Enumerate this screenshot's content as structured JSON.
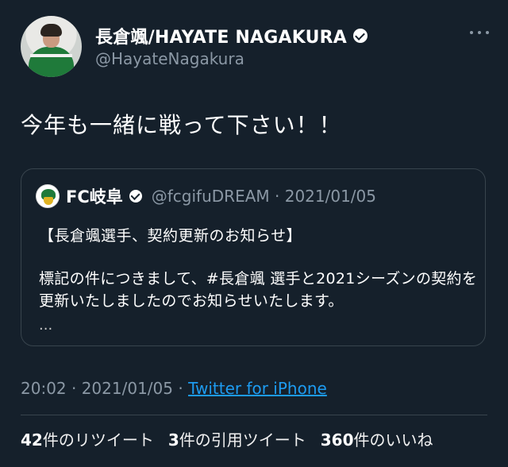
{
  "author": {
    "name": "長倉颯/HAYATE NAGAKURA",
    "handle": "@HayateNagakura",
    "verified": true
  },
  "tweet": {
    "text": "今年も一緒に戦って下さい！！"
  },
  "quoted": {
    "name": "FC岐阜",
    "handle_date": "@fcgifuDREAM · 2021/01/05",
    "title": "【長倉颯選手、契約更新のお知らせ】",
    "body": "標記の件につきまして、#長倉颯 選手と2021シーズンの契約を更新いたしましたのでお知らせいたします。",
    "ellipsis": "..."
  },
  "meta": {
    "time_date": "20:02 · 2021/01/05 · ",
    "source": "Twitter for iPhone"
  },
  "stats": {
    "retweets_num": "42",
    "retweets_label": "件のリツイート",
    "quotes_num": "3",
    "quotes_label": "件の引用ツイート",
    "likes_num": "360",
    "likes_label": "件のいいね"
  },
  "icons": {
    "verified": "verified-badge-icon",
    "more": "more-horizontal-icon"
  },
  "colors": {
    "background": "#15202b",
    "secondary_text": "#8b98a5",
    "link": "#1d9bf0",
    "border": "#38444d"
  }
}
